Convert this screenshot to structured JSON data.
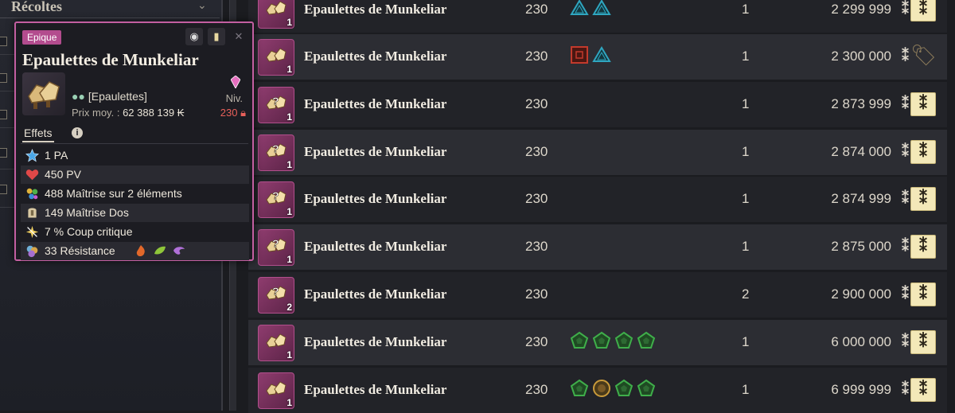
{
  "sidebar": {
    "category_title": "Récoltes"
  },
  "tooltip": {
    "rarity": "Epique",
    "title": "Epaulettes de Munkeliar",
    "type": "[Epaulettes]",
    "price_label": "Prix moy. :",
    "price_value": "62 388 139",
    "level_label": "Niv.",
    "level_value": "230",
    "effects_tab": "Effets",
    "effects": [
      {
        "icon": "ap-star-icon",
        "text": "1 PA"
      },
      {
        "icon": "heart-icon",
        "text": "450 PV"
      },
      {
        "icon": "elements-mastery-icon",
        "text": "488 Maîtrise sur 2 éléments"
      },
      {
        "icon": "rear-mastery-icon",
        "text": "149 Maîtrise Dos"
      },
      {
        "icon": "critical-icon",
        "text": "7 % Coup critique"
      },
      {
        "icon": "resistance-icon",
        "text": "33 Résistance"
      }
    ]
  },
  "kama_symbol": "⁑",
  "listings": [
    {
      "name": "Epaulettes de Munkeliar",
      "level": "230",
      "qty_badge": "1",
      "quantity": "1",
      "price": "2 299 999",
      "runes": [
        "triangle-blue",
        "triangle-blue"
      ],
      "action": "buy"
    },
    {
      "name": "Epaulettes de Munkeliar",
      "level": "230",
      "qty_badge": "1",
      "quantity": "1",
      "price": "2 300 000",
      "runes": [
        "square-red",
        "triangle-blue"
      ],
      "action": "tag"
    },
    {
      "name": "Epaulettes de Munkeliar",
      "level": "230",
      "qty_badge": "1",
      "quantity": "1",
      "price": "2 873 999",
      "runes": [],
      "action": "buy"
    },
    {
      "name": "Epaulettes de Munkeliar",
      "level": "230",
      "qty_badge": "1",
      "quantity": "1",
      "price": "2 874 000",
      "runes": [],
      "action": "buy"
    },
    {
      "name": "Epaulettes de Munkeliar",
      "level": "230",
      "qty_badge": "1",
      "quantity": "1",
      "price": "2 874 999",
      "runes": [],
      "action": "buy"
    },
    {
      "name": "Epaulettes de Munkeliar",
      "level": "230",
      "qty_badge": "1",
      "quantity": "1",
      "price": "2 875 000",
      "runes": [],
      "action": "buy"
    },
    {
      "name": "Epaulettes de Munkeliar",
      "level": "230",
      "qty_badge": "2",
      "quantity": "2",
      "price": "2 900 000",
      "runes": [],
      "action": "buy"
    },
    {
      "name": "Epaulettes de Munkeliar",
      "level": "230",
      "qty_badge": "1",
      "quantity": "1",
      "price": "6 000 000",
      "runes": [
        "pentagon-green",
        "pentagon-green",
        "pentagon-green",
        "pentagon-green"
      ],
      "action": "buy"
    },
    {
      "name": "Epaulettes de Munkeliar",
      "level": "230",
      "qty_badge": "1",
      "quantity": "1",
      "price": "6 999 999",
      "runes": [
        "pentagon-green",
        "circle-gold",
        "pentagon-green",
        "pentagon-green"
      ],
      "action": "buy"
    }
  ],
  "colors": {
    "rarity_epic": "#b34c8e",
    "rune_blue": "#2fa6c0",
    "rune_red": "#c23a2c",
    "rune_green": "#3fae4a",
    "rune_gold": "#c99a3a"
  }
}
